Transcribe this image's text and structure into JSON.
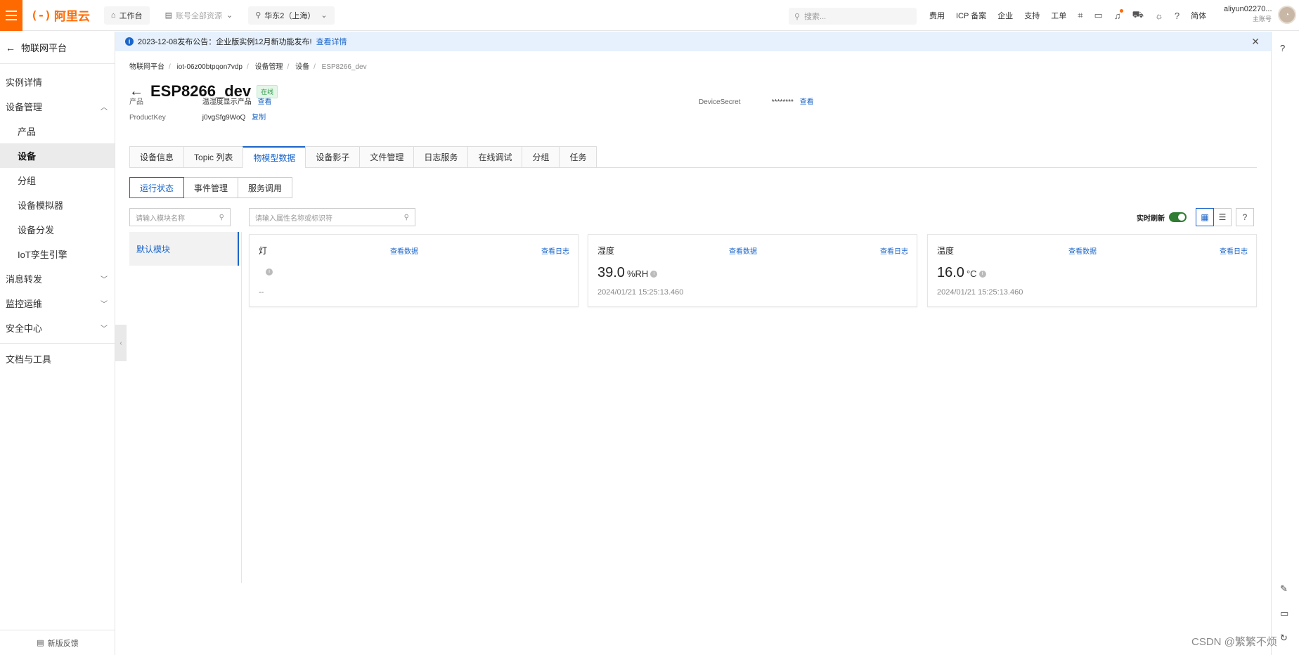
{
  "topbar": {
    "brand": "阿里云",
    "workbench": "工作台",
    "account_resources": "账号全部资源",
    "region": "华东2（上海）",
    "search_placeholder": "搜索...",
    "links": [
      "费用",
      "ICP 备案",
      "企业",
      "支持",
      "工单"
    ],
    "lang": "简体",
    "user_name": "aliyun02270...",
    "user_role": "主账号"
  },
  "sidebar": {
    "back_title": "物联网平台",
    "items": [
      {
        "label": "实例详情"
      },
      {
        "label": "设备管理"
      },
      {
        "label": "产品"
      },
      {
        "label": "设备"
      },
      {
        "label": "分组"
      },
      {
        "label": "设备模拟器"
      },
      {
        "label": "设备分发"
      },
      {
        "label": "IoT孪生引擎"
      },
      {
        "label": "消息转发"
      },
      {
        "label": "监控运维"
      },
      {
        "label": "安全中心"
      },
      {
        "label": "文档与工具"
      }
    ],
    "feedback": "新版反馈"
  },
  "notice": {
    "text": "2023-12-08发布公告：企业版实例12月新功能发布!",
    "link": "查看详情"
  },
  "breadcrumb": [
    "物联网平台",
    "iot-06z00btpqon7vdp",
    "设备管理",
    "设备",
    "ESP8266_dev"
  ],
  "device": {
    "title": "ESP8266_dev",
    "status": "在线",
    "product_label": "产品",
    "product_value": "温湿度显示产品",
    "product_action": "查看",
    "productkey_label": "ProductKey",
    "productkey_value": "j0vgSfg9WoQ",
    "productkey_action": "复制",
    "secret_label": "DeviceSecret",
    "secret_value": "********",
    "secret_action": "查看"
  },
  "tabs": [
    "设备信息",
    "Topic 列表",
    "物模型数据",
    "设备影子",
    "文件管理",
    "日志服务",
    "在线调试",
    "分组",
    "任务"
  ],
  "subtabs": [
    "运行状态",
    "事件管理",
    "服务调用"
  ],
  "module_search_placeholder": "请输入模块名称",
  "module_default": "默认模块",
  "prop_search_placeholder": "请输入属性名称或标识符",
  "realtime_label": "实时刷新",
  "cards": [
    {
      "name": "灯",
      "value": "",
      "unit": "",
      "time": "",
      "empty": "--",
      "view_data": "查看数据",
      "view_log": "查看日志"
    },
    {
      "name": "湿度",
      "value": "39.0",
      "unit": "%RH",
      "time": "2024/01/21 15:25:13.460",
      "empty": "",
      "view_data": "查看数据",
      "view_log": "查看日志"
    },
    {
      "name": "温度",
      "value": "16.0",
      "unit": "°C",
      "time": "2024/01/21 15:25:13.460",
      "empty": "",
      "view_data": "查看数据",
      "view_log": "查看日志"
    }
  ],
  "watermark": "CSDN @繁繁不烦"
}
